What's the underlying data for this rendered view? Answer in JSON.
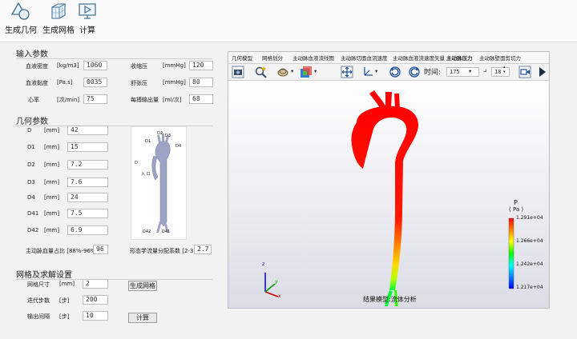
{
  "toolbar": {
    "geometry_label": "生成几何",
    "mesh_label": "生成网格",
    "compute_label": "计算"
  },
  "input_params": {
    "title": "输入参数",
    "rows": [
      {
        "label": "血液密度",
        "unit": "[kg/m3]",
        "value": "1060"
      },
      {
        "label": "血液黏度",
        "unit": "[Pa.s]",
        "value": "0035"
      },
      {
        "label": "心率",
        "unit": "[次/min]",
        "value": "75"
      }
    ],
    "rows_right": [
      {
        "label": "收缩压",
        "unit": "[mmHg]",
        "value": "120"
      },
      {
        "label": "舒张压",
        "unit": "[mmHg]",
        "value": "80"
      },
      {
        "label": "每搏输出量",
        "unit": "[ml/次]",
        "value": "68"
      }
    ]
  },
  "geometry_params": {
    "title": "几何参数",
    "rows": [
      {
        "label": "D",
        "unit": "[mm]",
        "value": "42"
      },
      {
        "label": "D1",
        "unit": "[mm]",
        "value": "15"
      },
      {
        "label": "D2",
        "unit": "[mm]",
        "value": "7.2"
      },
      {
        "label": "D3",
        "unit": "[mm]",
        "value": "7.6"
      },
      {
        "label": "D4",
        "unit": "[mm]",
        "value": "24"
      },
      {
        "label": "D41",
        "unit": "[mm]",
        "value": "7.5"
      },
      {
        "label": "D42",
        "unit": "[mm]",
        "value": "6.9"
      }
    ],
    "flow_ratio_label": "主动脉血量占比 [88%-96%]",
    "flow_ratio_value": "96",
    "morph_label": "形态学流量分配系数 [2-3]",
    "morph_value": "2.7",
    "thumb_labels": {
      "d1": "D1",
      "d2": "D2",
      "d3": "D3",
      "d4": "D4",
      "d": "D",
      "inlet": "入 口",
      "d42": "D42",
      "d41": "D41"
    }
  },
  "mesh_params": {
    "title": "网格及求解设置",
    "rows": [
      {
        "label": "网格尺寸",
        "unit": "[mm]",
        "value": "2"
      },
      {
        "label": "迭代步数",
        "unit": "[步]",
        "value": "200"
      },
      {
        "label": "输出间隔",
        "unit": "[步]",
        "value": "10"
      }
    ],
    "mesh_button": "生成网格",
    "compute_button": "计算"
  },
  "viewer": {
    "tabs": [
      "几何模型",
      "网格划分",
      "主动脉血液流线图",
      "主动脉切面血流速度",
      "主动脉血液流速度矢量",
      "主动脉压力",
      "主动脉壁面剪切力"
    ],
    "time_label": "时间:",
    "time_value": "175",
    "step_value": "18",
    "caption": "结果模型:流体分析",
    "legend": {
      "title_top": "P",
      "title_bottom": "( Pa )",
      "ticks": [
        "1.291e+04",
        "1.266e+04",
        "1.242e+04",
        "1.217e+04"
      ]
    },
    "axes": {
      "x": "x",
      "y": "y",
      "z": "z"
    }
  },
  "colors": {
    "pressure_high": "#ff0000",
    "pressure_mid": "#00ff00",
    "pressure_low": "#0000ff"
  }
}
